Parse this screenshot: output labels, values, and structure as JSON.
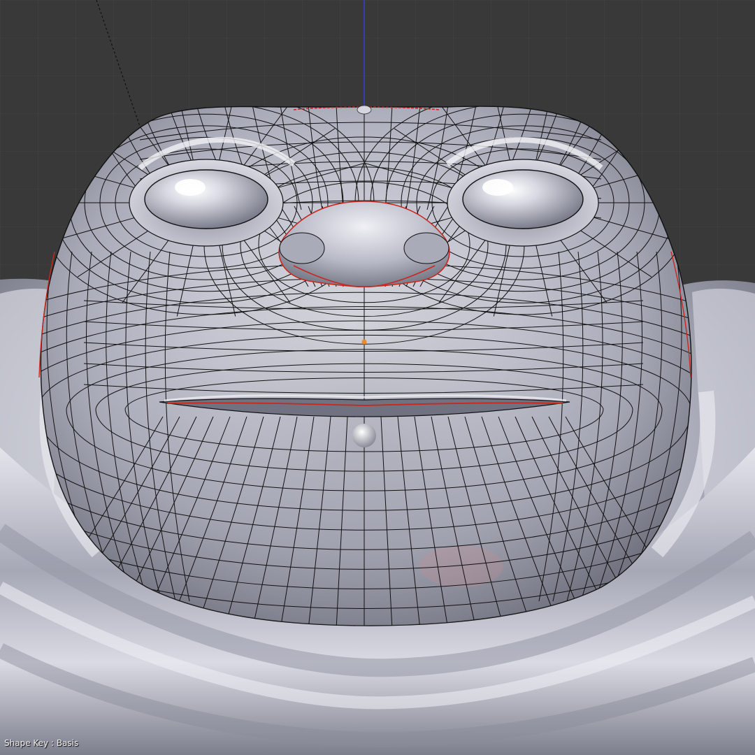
{
  "viewport": {
    "background_color": "#393939",
    "grid_color": "#444444",
    "shape_key_label": "Shape Key : Basis",
    "editor": "3D View",
    "mode": "Edit Mode",
    "shading": "solid",
    "wireframe_overlay": true
  },
  "colors": {
    "mesh_base": "#b9bbc8",
    "mesh_highlight": "#f6f6fa",
    "mesh_shadow": "#6e7080",
    "wire": "#111111",
    "seam": "#c8281e",
    "z_axis": "#3a3ad6",
    "vertex_selected": "#f08a24"
  },
  "icons": [
    "3d-cursor-icon",
    "pivot-dot-icon",
    "light-dashed-line-icon"
  ]
}
